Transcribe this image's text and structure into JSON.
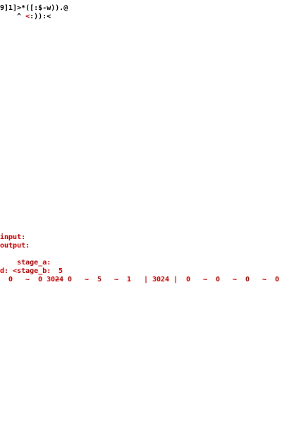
{
  "colors": {
    "text": "#000000",
    "highlight": "#d40000",
    "background": "#ffffff"
  },
  "program": {
    "code_line": "9]1]>*([:$-w)).@",
    "cursor_caret": "^",
    "cursor_hl_char": "<",
    "cursor_rest": ":)):<"
  },
  "status": {
    "input_label": "input:",
    "output_label": "output:",
    "stage_a_label": "stage_a:",
    "stage_a_value": "5",
    "stage_b_label": "stage_b:",
    "stage_b_value": "3024",
    "d_label": "d: <"
  },
  "tape": {
    "cells": [
      "0",
      "~",
      "0",
      "~",
      "0",
      "~",
      "5",
      "~",
      "1",
      "|",
      "3024",
      "|",
      "0",
      "~",
      "0",
      "~",
      "0",
      "~",
      "0"
    ]
  }
}
